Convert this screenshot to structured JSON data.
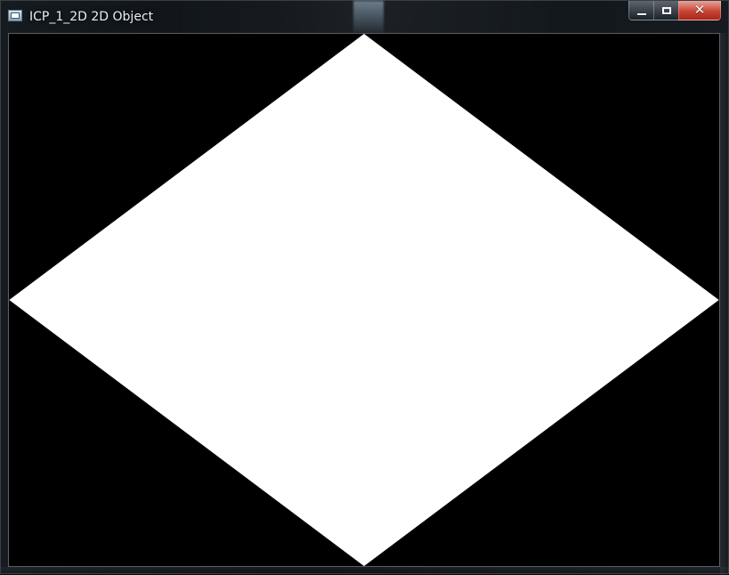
{
  "window": {
    "title": "ICP_1_2D 2D Object",
    "controls": {
      "minimize_icon": "minimize-icon",
      "maximize_icon": "maximize-icon",
      "close_icon": "close-icon"
    },
    "colors": {
      "frame": "#0e1216",
      "client_background": "#000000",
      "shape_fill": "#ffffff",
      "close_button": "#c84533"
    }
  }
}
